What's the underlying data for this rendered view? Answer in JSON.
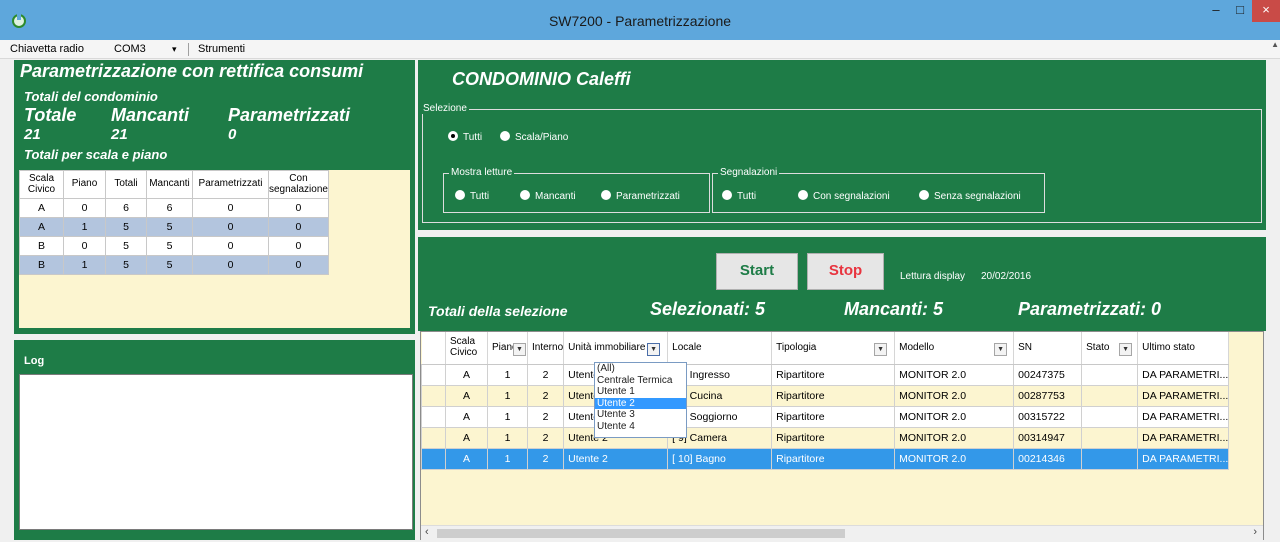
{
  "window": {
    "title": "SW7200 - Parametrizzazione",
    "minimize": "–",
    "maximize": "□",
    "close": "×"
  },
  "menu": {
    "radio_label": "Chiavetta radio",
    "port": "COM3",
    "dropdown_arrow": "▾",
    "tools": "Strumenti"
  },
  "summary": {
    "title": "Parametrizzazione con rettifica consumi",
    "totals_label": "Totali del condominio",
    "totale_label": "Totale",
    "mancanti_label": "Mancanti",
    "parametrizzati_label": "Parametrizzati",
    "totale": "21",
    "mancanti": "21",
    "parametrizzati": "0",
    "per_scala_label": "Totali per scala e piano"
  },
  "stats_table": {
    "headers": [
      "Scala Civico",
      "Piano",
      "Totali",
      "Mancanti",
      "Parametrizzati",
      "Con segnalazione"
    ],
    "rows": [
      [
        "A",
        "0",
        "6",
        "6",
        "0",
        "0"
      ],
      [
        "A",
        "1",
        "5",
        "5",
        "0",
        "0"
      ],
      [
        "B",
        "0",
        "5",
        "5",
        "0",
        "0"
      ],
      [
        "B",
        "1",
        "5",
        "5",
        "0",
        "0"
      ]
    ]
  },
  "log": {
    "label": "Log"
  },
  "condominio": {
    "title": "CONDOMINIO Caleffi"
  },
  "selezione": {
    "label": "Selezione",
    "options": [
      "Tutti",
      "Scala/Piano"
    ],
    "selected": "Tutti",
    "mostra_letture": {
      "label": "Mostra letture",
      "options": [
        "Tutti",
        "Mancanti",
        "Parametrizzati"
      ]
    },
    "segnalazioni": {
      "label": "Segnalazioni",
      "options": [
        "Tutti",
        "Con segnalazioni",
        "Senza segnalazioni"
      ]
    }
  },
  "actions": {
    "start": "Start",
    "stop": "Stop",
    "start_color": "#1e7c47",
    "stop_color": "#e8343f",
    "lettura_display": "Lettura display",
    "date": "20/02/2016"
  },
  "totals_selection": {
    "label": "Totali della selezione",
    "selezionati": "Selezionati: 5",
    "mancanti": "Mancanti: 5",
    "parametrizzati": "Parametrizzati: 0"
  },
  "grid": {
    "columns": [
      "Scala Civico",
      "Piano",
      "Interno",
      "Unità immobiliare",
      "Locale",
      "Tipologia",
      "Modello",
      "SN",
      "Stato",
      "Ultimo stato"
    ],
    "rows": [
      [
        "A",
        "1",
        "2",
        "Utente 2",
        "[ 6] Ingresso",
        "Ripartitore",
        "MONITOR 2.0",
        "00247375",
        "",
        "DA PARAMETRI..."
      ],
      [
        "A",
        "1",
        "2",
        "Utente 2",
        "[ 7] Cucina",
        "Ripartitore",
        "MONITOR 2.0",
        "00287753",
        "",
        "DA PARAMETRI..."
      ],
      [
        "A",
        "1",
        "2",
        "Utente 2",
        "[ 8] Soggiorno",
        "Ripartitore",
        "MONITOR 2.0",
        "00315722",
        "",
        "DA PARAMETRI..."
      ],
      [
        "A",
        "1",
        "2",
        "Utente 2",
        "[ 9] Camera",
        "Ripartitore",
        "MONITOR 2.0",
        "00314947",
        "",
        "DA PARAMETRI..."
      ],
      [
        "A",
        "1",
        "2",
        "Utente 2",
        "[ 10] Bagno",
        "Ripartitore",
        "MONITOR 2.0",
        "00214346",
        "",
        "DA PARAMETRI..."
      ]
    ],
    "selected_row": 4,
    "filter_options": [
      "(All)",
      "Centrale Termica",
      "Utente 1",
      "Utente 2",
      "Utente 3",
      "Utente 4"
    ],
    "filter_highlight": "Utente 2"
  },
  "colors": {
    "panel_green": "#1e7c47",
    "row_alt": "#fcf5d0",
    "row_selected": "#3398e9",
    "stats_alt": "#b3c5de",
    "titlebar": "#5ea7dc"
  }
}
